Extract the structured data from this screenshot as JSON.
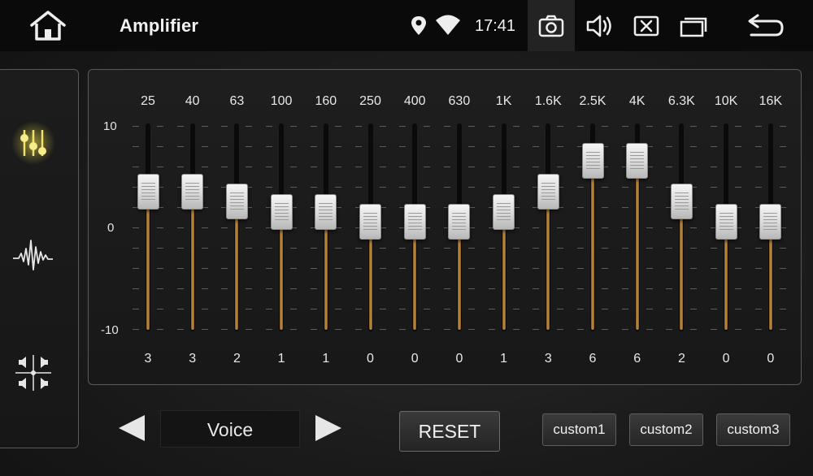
{
  "statusbar": {
    "title": "Amplifier",
    "time": "17:41",
    "icons": [
      "home-icon",
      "location-pin-icon",
      "wifi-icon",
      "camera-icon",
      "volume-icon",
      "close-box-icon",
      "recent-apps-icon",
      "back-icon"
    ]
  },
  "sidebar": {
    "items": [
      {
        "icon": "equalizer-sliders-icon",
        "active": true
      },
      {
        "icon": "waveform-icon",
        "active": false
      },
      {
        "icon": "speaker-balance-icon",
        "active": false
      }
    ]
  },
  "equalizer": {
    "axis": {
      "max_label": "10",
      "zero_label": "0",
      "min_label": "-10",
      "max": 10,
      "min": -10
    },
    "bands": [
      {
        "freq": "25",
        "value": 3
      },
      {
        "freq": "40",
        "value": 3
      },
      {
        "freq": "63",
        "value": 2
      },
      {
        "freq": "100",
        "value": 1
      },
      {
        "freq": "160",
        "value": 1
      },
      {
        "freq": "250",
        "value": 0
      },
      {
        "freq": "400",
        "value": 0
      },
      {
        "freq": "630",
        "value": 0
      },
      {
        "freq": "1K",
        "value": 1
      },
      {
        "freq": "1.6K",
        "value": 3
      },
      {
        "freq": "2.5K",
        "value": 6
      },
      {
        "freq": "4K",
        "value": 6
      },
      {
        "freq": "6.3K",
        "value": 2
      },
      {
        "freq": "10K",
        "value": 0
      },
      {
        "freq": "16K",
        "value": 0
      }
    ]
  },
  "controls": {
    "preset": "Voice",
    "reset_label": "RESET",
    "custom_buttons": [
      "custom1",
      "custom2",
      "custom3"
    ]
  },
  "colors": {
    "accent_gold": "#e8d84a",
    "fill_bronze": "#c69040",
    "background": "#1b1b1b"
  }
}
